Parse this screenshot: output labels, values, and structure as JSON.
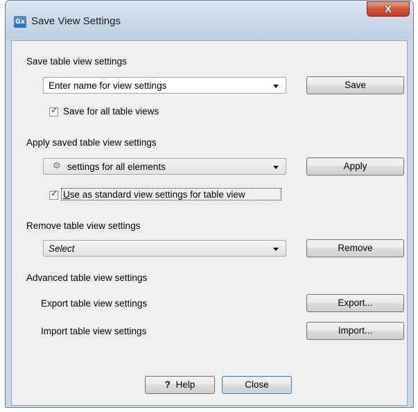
{
  "window": {
    "title": "Save View Settings",
    "app_icon_text": "Gx",
    "close_glyph": "X"
  },
  "save_section": {
    "heading": "Save table view settings",
    "name_input_value": "Enter name for view settings",
    "save_button": "Save",
    "checkbox_label": "Save for all table views",
    "checkbox_checked": true
  },
  "apply_section": {
    "heading": "Apply saved table view settings",
    "selected_settings": "settings for all elements",
    "selected_icon": "gear-icon",
    "apply_button": "Apply",
    "checkbox_label_mnemonic": "U",
    "checkbox_label_rest": "se as standard view settings for table view",
    "checkbox_checked": true
  },
  "remove_section": {
    "heading": "Remove table view settings",
    "select_value": "Select",
    "remove_button": "Remove"
  },
  "advanced_section": {
    "heading": "Advanced table view settings",
    "export_label": "Export table view settings",
    "export_button": "Export...",
    "import_label": "Import table view settings",
    "import_button": "Import..."
  },
  "footer": {
    "help_icon": "?",
    "help_button": "Help",
    "close_button": "Close"
  }
}
